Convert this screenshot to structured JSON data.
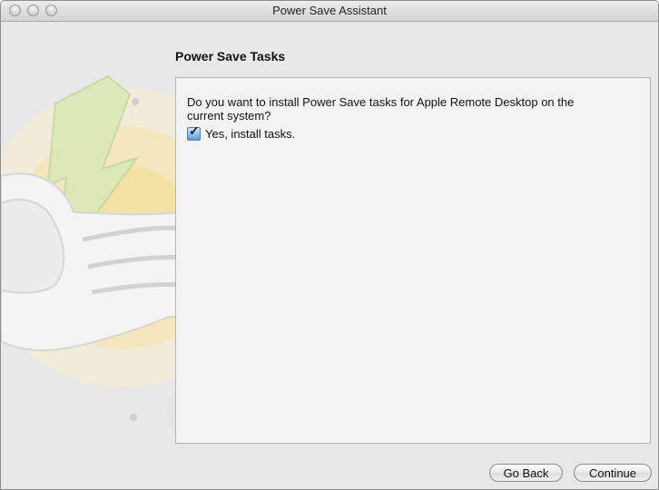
{
  "window": {
    "title": "Power Save Assistant"
  },
  "page": {
    "section_title": "Power Save Tasks",
    "question": "Do you want to install Power Save tasks for Apple Remote Desktop on the current system?",
    "checkbox_label": "Yes, install tasks.",
    "checkbox_checked": true
  },
  "buttons": {
    "back_label": "Go Back",
    "continue_label": "Continue"
  },
  "colors": {
    "window_background": "#e8e8e8",
    "pane_background": "#f3f3f3",
    "checkbox_blue": "#5e9ae3"
  }
}
